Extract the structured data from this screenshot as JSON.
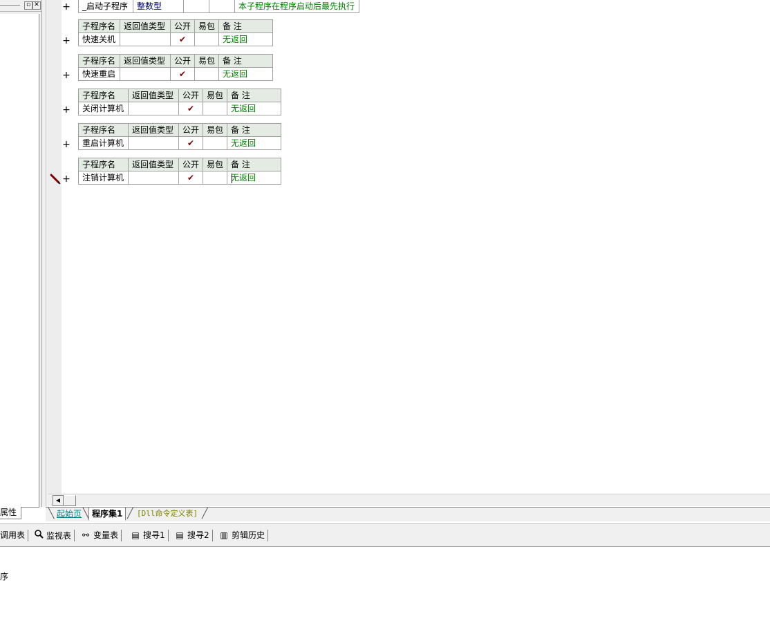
{
  "left_panel": {
    "title": "",
    "pin_icon": "pin-icon",
    "close_icon": "close-icon",
    "pin_glyph": "▫",
    "close_glyph": "✕",
    "property_tab": "属性"
  },
  "top_row": {
    "name": "_启动子程序",
    "return_type": "整数型",
    "public": "",
    "easy_lang": "",
    "note": "本子程序在程序启动后最先执行"
  },
  "table_headers": {
    "name": "子程序名",
    "return_type": "返回值类型",
    "public": "公开",
    "easy_lang": "易包",
    "note": "备 注"
  },
  "subroutines": [
    {
      "name": "快速关机",
      "return_type": "",
      "public": "✔",
      "easy_lang": "",
      "note": "无返回"
    },
    {
      "name": "快速重启",
      "return_type": "",
      "public": "✔",
      "easy_lang": "",
      "note": "无返回"
    },
    {
      "name": "关闭计算机",
      "return_type": "",
      "public": "✔",
      "easy_lang": "",
      "note": "无返回"
    },
    {
      "name": "重启计算机",
      "return_type": "",
      "public": "✔",
      "easy_lang": "",
      "note": "无返回"
    },
    {
      "name": "注销计算机",
      "return_type": "",
      "public": "✔",
      "easy_lang": "",
      "note": "无返回"
    }
  ],
  "expand_symbol": "+",
  "tabs": {
    "start_page": "起始页",
    "program_set": "程序集1",
    "dll_table": "[Dll命令定义表]"
  },
  "bottom_toolbar": [
    {
      "label": "调用表",
      "icon": ""
    },
    {
      "label": "监视表",
      "icon": "search-icon",
      "glyph": "🔍"
    },
    {
      "label": "变量表",
      "icon": "variable-icon",
      "glyph": "⚯"
    },
    {
      "label": "搜寻1",
      "icon": "find1-icon",
      "glyph": "▤"
    },
    {
      "label": "搜寻2",
      "icon": "find2-icon",
      "glyph": "▤"
    },
    {
      "label": "剪辑历史",
      "icon": "clip-history-icon",
      "glyph": "▥"
    }
  ],
  "output": {
    "text": "序"
  },
  "colors": {
    "header_bg": "#e3ebe3",
    "note_green": "#008000",
    "type_navy": "#000080",
    "check_red": "#800000"
  }
}
